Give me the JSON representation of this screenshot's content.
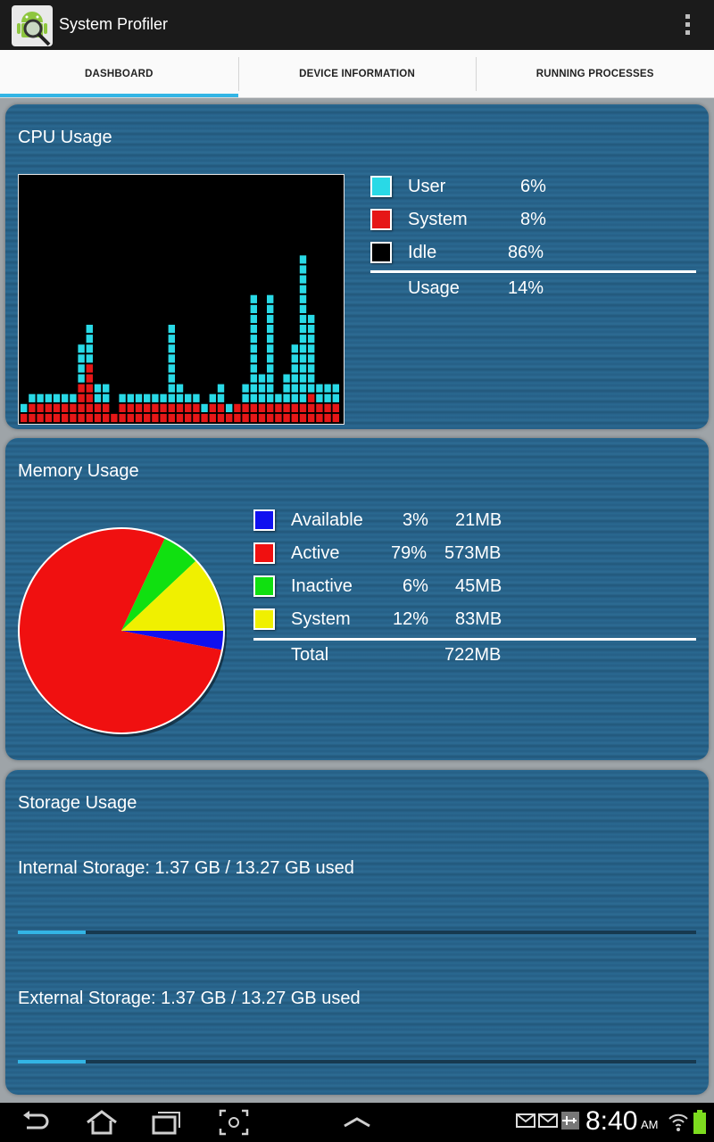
{
  "app": {
    "title": "System Profiler",
    "icon": "android-magnifier-icon"
  },
  "tabs": [
    {
      "label": "DASHBOARD",
      "active": true
    },
    {
      "label": "DEVICE INFORMATION",
      "active": false
    },
    {
      "label": "RUNNING PROCESSES",
      "active": false
    }
  ],
  "cpu": {
    "title": "CPU Usage",
    "legend": [
      {
        "label": "User",
        "value": "6%",
        "color": "#29d9e6"
      },
      {
        "label": "System",
        "value": "8%",
        "color": "#e61717"
      },
      {
        "label": "Idle",
        "value": "86%",
        "color": "#000000"
      }
    ],
    "total": {
      "label": "Usage",
      "value": "14%"
    },
    "history_units": {
      "system": [
        1,
        2,
        2,
        2,
        2,
        2,
        2,
        4,
        6,
        2,
        2,
        1,
        2,
        2,
        2,
        2,
        2,
        2,
        2,
        2,
        2,
        2,
        1,
        2,
        2,
        1,
        2,
        2,
        2,
        2,
        2,
        2,
        2,
        2,
        2,
        3,
        2,
        2,
        2
      ],
      "user": [
        1,
        1,
        1,
        1,
        1,
        1,
        1,
        4,
        4,
        2,
        2,
        0,
        1,
        1,
        1,
        1,
        1,
        1,
        8,
        2,
        1,
        1,
        1,
        1,
        2,
        1,
        0,
        2,
        11,
        3,
        11,
        1,
        3,
        6,
        15,
        8,
        2,
        2,
        2
      ]
    },
    "colors": {
      "user": "#29d9e6",
      "system": "#e61717"
    }
  },
  "memory": {
    "title": "Memory Usage",
    "legend": [
      {
        "label": "Available",
        "percent": "3%",
        "size": "21MB",
        "color": "#1010f0",
        "value": 3
      },
      {
        "label": "Active",
        "percent": "79%",
        "size": "573MB",
        "color": "#f01010",
        "value": 79
      },
      {
        "label": "Inactive",
        "percent": "6%",
        "size": "45MB",
        "color": "#10e010",
        "value": 6
      },
      {
        "label": "System",
        "percent": "12%",
        "size": "83MB",
        "color": "#f0f000",
        "value": 12
      }
    ],
    "total": {
      "label": "Total",
      "size": "722MB"
    }
  },
  "storage": {
    "title": "Storage Usage",
    "internal": {
      "text": "Internal Storage: 1.37 GB / 13.27 GB used",
      "fraction": 0.1
    },
    "external": {
      "text": "External Storage: 1.37 GB / 13.27 GB used",
      "fraction": 0.1
    }
  },
  "status": {
    "time": "8:40",
    "ampm": "AM"
  }
}
